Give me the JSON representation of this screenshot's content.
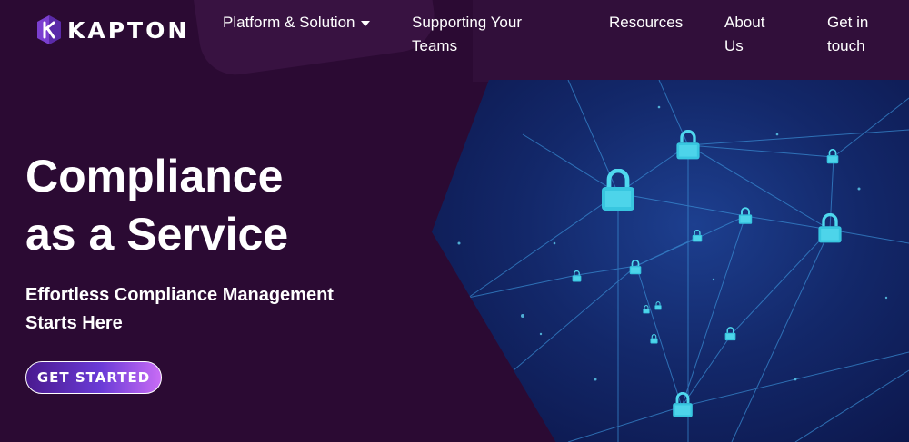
{
  "brand": {
    "name": "KAPTON",
    "accent": "#8b4fd9"
  },
  "nav": {
    "platform": "Platform & Solution",
    "supporting_line1": "Supporting Your",
    "supporting_line2": "Teams",
    "resources": "Resources",
    "about_line1": "About",
    "about_line2": "Us",
    "contact_line1": "Get in",
    "contact_line2": "touch"
  },
  "hero": {
    "title_line1": "Compliance",
    "title_line2": "as a Service",
    "subtitle_line1": "Effortless Compliance Management",
    "subtitle_line2": "Starts Here",
    "cta_label": "GET STARTED"
  },
  "colors": {
    "background": "#2b0a33",
    "cta_gradient_start": "#4a1a8f",
    "cta_gradient_end": "#c86cf5",
    "lock": "#38c6e0"
  },
  "icons": [
    "kapton-logo-icon",
    "chevron-down-icon",
    "padlock-icon"
  ]
}
